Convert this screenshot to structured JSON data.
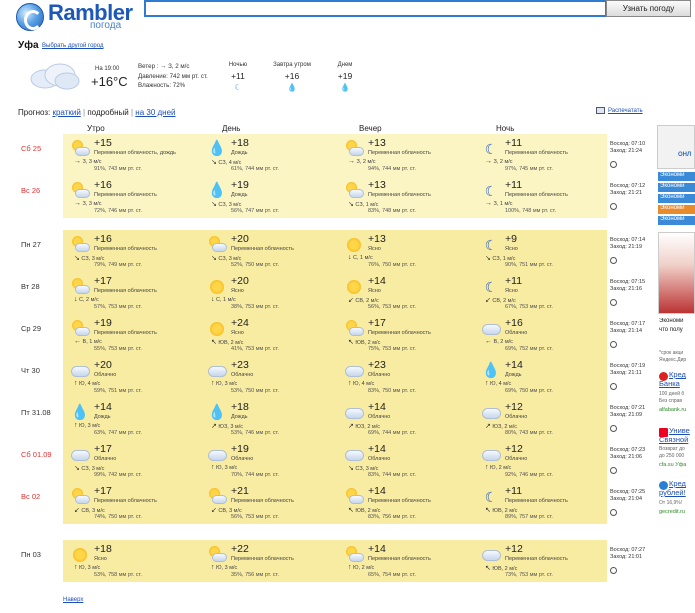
{
  "header": {
    "logo": "Rambler",
    "logo_sub": "погода",
    "search_value": "",
    "search_button": "Узнать погоду"
  },
  "city": {
    "name": "Уфа",
    "change_link": "Выбрать другой город"
  },
  "current": {
    "time": "На 19:00",
    "temp": "+16°C",
    "wind": "Ветер : → З, 2 м/с",
    "pressure": "Давление: 742 мм рт. ст.",
    "humidity": "Влажность: 72%",
    "forecasts": [
      {
        "label": "Ночью",
        "temp": "+11",
        "icon": "moon-icon"
      },
      {
        "label": "Завтра утром",
        "temp": "+16",
        "icon": "drop-icon"
      },
      {
        "label": "Днем",
        "temp": "+19",
        "icon": "drop-icon"
      }
    ]
  },
  "forecast_switch": {
    "label": "Прогноз:",
    "short": "краткий",
    "detailed": "подробный",
    "month": "на 30 дней",
    "sep": "|"
  },
  "print_label": "Распечатать",
  "columns": [
    "Утро",
    "День",
    "Вечер",
    "Ночь"
  ],
  "rows": [
    {
      "day": "Сб 25",
      "weekend": true,
      "sun": "Восход: 07:10",
      "sunset": "Заход: 21:24",
      "cells": [
        {
          "icon": "sun-cloud",
          "temp": "+15",
          "cond": "Переменная облачность, дождь",
          "wind": "З, 3 м/с",
          "dir": "→",
          "press": "91%, 743 мм рт. ст."
        },
        {
          "icon": "drop",
          "temp": "+18",
          "cond": "Дождь",
          "wind": "СЗ, 4 м/с",
          "dir": "↘",
          "press": "61%, 744 мм рт. ст."
        },
        {
          "icon": "sun-cloud",
          "temp": "+13",
          "cond": "Переменная облачность",
          "wind": "З, 2 м/с",
          "dir": "→",
          "press": "94%, 744 мм рт. ст."
        },
        {
          "icon": "moon",
          "temp": "+11",
          "cond": "Переменная облачность",
          "wind": "З, 2 м/с",
          "dir": "→",
          "press": "97%, 745 мм рт. ст."
        }
      ]
    },
    {
      "day": "Вс 26",
      "weekend": true,
      "sun": "Восход: 07:12",
      "sunset": "Заход: 21:21",
      "cells": [
        {
          "icon": "sun-cloud",
          "temp": "+16",
          "cond": "Переменная облачность",
          "wind": "З, 3 м/с",
          "dir": "→",
          "press": "72%, 746 мм рт. ст."
        },
        {
          "icon": "drop",
          "temp": "+19",
          "cond": "Дождь",
          "wind": "СЗ, 3 м/с",
          "dir": "↘",
          "press": "56%, 747 мм рт. ст."
        },
        {
          "icon": "sun-cloud",
          "temp": "+13",
          "cond": "Переменная облачность",
          "wind": "СЗ, 1 м/с",
          "dir": "↘",
          "press": "83%, 748 мм рт. ст."
        },
        {
          "icon": "moon",
          "temp": "+11",
          "cond": "Переменная облачность",
          "wind": "З, 1 м/с",
          "dir": "→",
          "press": "100%, 748 мм рт. ст."
        }
      ]
    },
    {
      "day": "Пн 27",
      "weekend": false,
      "sun": "Восход: 07:14",
      "sunset": "Заход: 21:19",
      "cells": [
        {
          "icon": "sun-cloud",
          "temp": "+16",
          "cond": "Переменная облачность",
          "wind": "СЗ, 3 м/с",
          "dir": "↘",
          "press": "79%, 749 мм рт. ст."
        },
        {
          "icon": "sun-cloud",
          "temp": "+20",
          "cond": "Переменная облачность",
          "wind": "СЗ, 3 м/с",
          "dir": "↘",
          "press": "52%, 750 мм рт. ст."
        },
        {
          "icon": "sun",
          "temp": "+13",
          "cond": "Ясно",
          "wind": "С, 1 м/с",
          "dir": "↓",
          "press": "76%, 750 мм рт. ст."
        },
        {
          "icon": "moon",
          "temp": "+9",
          "cond": "Ясно",
          "wind": "СЗ, 1 м/с",
          "dir": "↘",
          "press": "90%, 751 мм рт. ст."
        }
      ]
    },
    {
      "day": "Вт 28",
      "weekend": false,
      "sun": "Восход: 07:15",
      "sunset": "Заход: 21:16",
      "cells": [
        {
          "icon": "sun-cloud",
          "temp": "+17",
          "cond": "Переменная облачность",
          "wind": "С, 2 м/с",
          "dir": "↓",
          "press": "57%, 753 мм рт. ст."
        },
        {
          "icon": "sun",
          "temp": "+20",
          "cond": "Ясно",
          "wind": "С, 1 м/с",
          "dir": "↓",
          "press": "38%, 753 мм рт. ст."
        },
        {
          "icon": "sun",
          "temp": "+14",
          "cond": "Ясно",
          "wind": "СВ, 2 м/с",
          "dir": "↙",
          "press": "56%, 753 мм рт. ст."
        },
        {
          "icon": "moon",
          "temp": "+11",
          "cond": "Ясно",
          "wind": "СВ, 2 м/с",
          "dir": "↙",
          "press": "67%, 753 мм рт. ст."
        }
      ]
    },
    {
      "day": "Ср 29",
      "weekend": false,
      "sun": "Восход: 07:17",
      "sunset": "Заход: 21:14",
      "cells": [
        {
          "icon": "sun-cloud",
          "temp": "+19",
          "cond": "Переменная облачность",
          "wind": "В, 1 м/с",
          "dir": "←",
          "press": "55%, 753 мм рт. ст."
        },
        {
          "icon": "sun",
          "temp": "+24",
          "cond": "Ясно",
          "wind": "ЮВ, 2 м/с",
          "dir": "↖",
          "press": "41%, 753 мм рт. ст."
        },
        {
          "icon": "sun-cloud",
          "temp": "+17",
          "cond": "Переменная облачность",
          "wind": "ЮВ, 2 м/с",
          "dir": "↖",
          "press": "75%, 753 мм рт. ст."
        },
        {
          "icon": "cloud",
          "temp": "+16",
          "cond": "Облачно",
          "wind": "В, 2 м/с",
          "dir": "←",
          "press": "69%, 752 мм рт. ст."
        }
      ]
    },
    {
      "day": "Чт 30",
      "weekend": false,
      "sun": "Восход: 07:19",
      "sunset": "Заход: 21:11",
      "cells": [
        {
          "icon": "cloud",
          "temp": "+20",
          "cond": "Облачно",
          "wind": "Ю, 4 м/с",
          "dir": "↑",
          "press": "59%, 751 мм рт. ст."
        },
        {
          "icon": "cloud",
          "temp": "+23",
          "cond": "Облачно",
          "wind": "Ю, 3 м/с",
          "dir": "↑",
          "press": "53%, 750 мм рт. ст."
        },
        {
          "icon": "cloud",
          "temp": "+23",
          "cond": "Облачно",
          "wind": "Ю, 4 м/с",
          "dir": "↑",
          "press": "83%, 750 мм рт. ст."
        },
        {
          "icon": "drop",
          "temp": "+14",
          "cond": "Дождь",
          "wind": "Ю, 4 м/с",
          "dir": "↑",
          "press": "69%, 750 мм рт. ст."
        }
      ]
    },
    {
      "day": "Пт 31.08",
      "weekend": false,
      "sun": "Восход: 07:21",
      "sunset": "Заход: 21:09",
      "cells": [
        {
          "icon": "drop",
          "temp": "+14",
          "cond": "Дождь",
          "wind": "Ю, 3 м/с",
          "dir": "↑",
          "press": "63%, 747 мм рт. ст."
        },
        {
          "icon": "drop",
          "temp": "+18",
          "cond": "Дождь",
          "wind": "ЮЗ, 3 м/с",
          "dir": "↗",
          "press": "53%, 746 мм рт. ст."
        },
        {
          "icon": "cloud",
          "temp": "+14",
          "cond": "Облачно",
          "wind": "ЮЗ, 2 м/с",
          "dir": "↗",
          "press": "69%, 744 мм рт. ст."
        },
        {
          "icon": "cloud",
          "temp": "+12",
          "cond": "Облачно",
          "wind": "ЮЗ, 2 м/с",
          "dir": "↗",
          "press": "80%, 743 мм рт. ст."
        }
      ]
    },
    {
      "day": "Сб 01.09",
      "weekend": true,
      "sun": "Восход: 07:23",
      "sunset": "Заход: 21:06",
      "cells": [
        {
          "icon": "cloud",
          "temp": "+17",
          "cond": "Облачно",
          "wind": "СЗ, 3 м/с",
          "dir": "↘",
          "press": "99%, 742 мм рт. ст."
        },
        {
          "icon": "cloud",
          "temp": "+19",
          "cond": "Облачно",
          "wind": "Ю, 3 м/с",
          "dir": "↑",
          "press": "70%, 744 мм рт. ст."
        },
        {
          "icon": "cloud",
          "temp": "+14",
          "cond": "Облачно",
          "wind": "СЗ, 3 м/с",
          "dir": "↘",
          "press": "83%, 744 мм рт. ст."
        },
        {
          "icon": "cloud",
          "temp": "+12",
          "cond": "Облачно",
          "wind": "Ю, 2 м/с",
          "dir": "↑",
          "press": "92%, 746 мм рт. ст."
        }
      ]
    },
    {
      "day": "Вс 02",
      "weekend": true,
      "sun": "Восход: 07:25",
      "sunset": "Заход: 21:04",
      "cells": [
        {
          "icon": "sun-cloud",
          "temp": "+17",
          "cond": "Переменная облачность",
          "wind": "СВ, 3 м/с",
          "dir": "↙",
          "press": "74%, 750 мм рт. ст."
        },
        {
          "icon": "sun-cloud",
          "temp": "+21",
          "cond": "Переменная облачность",
          "wind": "СВ, 3 м/с",
          "dir": "↙",
          "press": "56%, 753 мм рт. ст."
        },
        {
          "icon": "sun-cloud",
          "temp": "+14",
          "cond": "Переменная облачность",
          "wind": "ЮВ, 2 м/с",
          "dir": "↖",
          "press": "83%, 756 мм рт. ст."
        },
        {
          "icon": "moon",
          "temp": "+11",
          "cond": "Переменная облачность",
          "wind": "ЮВ, 2 м/с",
          "dir": "↖",
          "press": "89%, 757 мм рт. ст."
        }
      ]
    },
    {
      "day": "Пн 03",
      "weekend": false,
      "sun": "Восход: 07:27",
      "sunset": "Заход: 21:01",
      "cells": [
        {
          "icon": "sun",
          "temp": "+18",
          "cond": "Ясно",
          "wind": "Ю, 3 м/с",
          "dir": "↑",
          "press": "53%, 758 мм рт. ст."
        },
        {
          "icon": "sun-cloud",
          "temp": "+22",
          "cond": "Переменная облачность",
          "wind": "Ю, 3 м/с",
          "dir": "↑",
          "press": "35%, 756 мм рт. ст."
        },
        {
          "icon": "sun-cloud",
          "temp": "+14",
          "cond": "Переменная облачность",
          "wind": "Ю, 2 м/с",
          "dir": "↑",
          "press": "65%, 754 мм рт. ст."
        },
        {
          "icon": "cloud",
          "temp": "+12",
          "cond": "Переменная облачность",
          "wind": "ЮВ, 2 м/с",
          "dir": "↖",
          "press": "73%, 753 мм рт. ст."
        }
      ]
    }
  ],
  "back_link": "Наверх",
  "ad": {
    "top_label": "ОНЛ",
    "tabs": [
      {
        "text": "Экономи",
        "color": "#3b8ad8"
      },
      {
        "text": "Экономи",
        "color": "#3b8ad8"
      },
      {
        "text": "Экономи",
        "color": "#3b8ad8"
      },
      {
        "text": "Экономи",
        "color": "#e88b2c"
      },
      {
        "text": "Экономи",
        "color": "#3b8ad8"
      }
    ],
    "promo_1": "Экономи",
    "promo_2": "что полу",
    "promo_3": "*срок акци",
    "promo_4": "Яндекс.Дир",
    "bank_1_title": "Кред",
    "bank_1_title2": "Банка",
    "bank_1_text": "100 дней б",
    "bank_1_text2": "Без справ",
    "bank_1_site": "alfabank.ru",
    "bank_2_title": "Униве",
    "bank_2_title2": "Связной",
    "bank_2_text": "Возврат до",
    "bank_2_text2": "до 250 000",
    "bank_2_site": "cfa.su Уфа",
    "bank_3_title": "Кред",
    "bank_3_title2": "рублей!",
    "bank_3_text": "От 16,9%!",
    "bank_3_site": "gecredit.ru"
  }
}
